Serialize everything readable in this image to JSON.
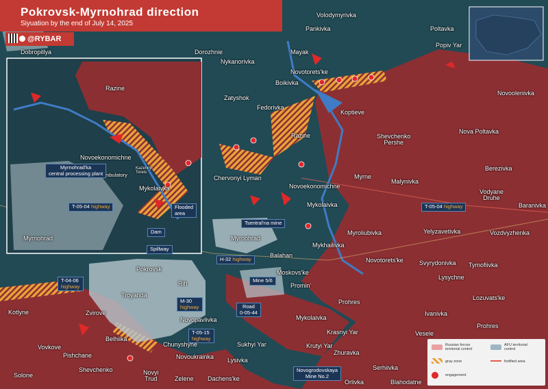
{
  "header": {
    "title": "Pokrovsk-Myrnohrad direction",
    "subtitle": "Siyuation by the end of July 14, 2025"
  },
  "brand": {
    "name": "@RYBAR"
  },
  "colors": {
    "russian": "#8c2f33",
    "ukrainian": "#214a55",
    "gray_zone": "#e8a23a",
    "engagement": "#e02828",
    "urban": "#b6c6cc",
    "water": "#3f7cc5",
    "header": "#c23a33"
  },
  "towns": {
    "volodymyrivka": "Volodymyrivka",
    "pankivka": "Pankivka",
    "poltavka": "Poltavka",
    "popiv_yar": "Popiv Yar",
    "dobropillya": "Dobropillya",
    "dorozhnie": "Dorozhnie",
    "mayak": "Mayak",
    "novotoretske_n": "Novotorets'ke",
    "nykanorivka": "Nykanorivka",
    "boikivka": "Boikivka",
    "novoolenivka": "Novoolenivka",
    "zatyshok": "Zatyshok",
    "fedorivka": "Fedorivka",
    "koptieve": "Koptieve",
    "nova_poltavka": "Nova Poltavka",
    "shevchenko_pershe": "Shevchenko\nPershe",
    "razine_main": "Razine",
    "berezivka": "Berezivka",
    "chervonyi_lyman": "Chervonyi Lyman",
    "myrne": "Myrne",
    "malynivka": "Malynivka",
    "vodyane_druhe": "Vodyane\nDruhe",
    "novoekonomichne_main": "Novoekonomichne",
    "baranivka": "Baranivka",
    "mykolaivka_main": "Mykolaivka",
    "myrnohrad_main": "Myrnohrad",
    "myroliubivka": "Myroliubivka",
    "yelyzavetivka": "Yelyzavetivka",
    "vozdvyzhenka": "Vozdvyzhenka",
    "mykhailivka": "Mykhailivka",
    "novotoretske_s": "Novotorets'ke",
    "svyrydonivka": "Svyrydonivka",
    "tymofiivka": "Tymofiivka",
    "balahan": "Balahan",
    "pokrovsk": "Pokrovsk",
    "moskovske": "Moskovs'ke",
    "lysychne": "Lysychne",
    "lozuvatske": "Lozuvats'ke",
    "promin": "Promin'",
    "rih": "Rih",
    "troyanda": "Troyanda",
    "prohres": "Prohres",
    "kotlyne": "Kotlyne",
    "zvirove": "Zvirove",
    "ivanivka": "Ivanivka",
    "mykolaivka_s": "Mykolaivka",
    "novopavlivka": "Novopavlivka",
    "vesele": "Vesele",
    "belhiika": "Belhiika",
    "krasnyi_yar": "Krasnyi Yar",
    "vovkove": "Vovkove",
    "chunyshyne": "Chunyshyne",
    "sukhyi_yar": "Sukhyi Yar",
    "pishchane": "Pishchane",
    "novoukrainka": "Novoukrainka",
    "krutyi_yar": "Krutyi Yar",
    "zhuravka": "Zhuravka",
    "shevchenko_s": "Shevchenko",
    "lysivka": "Lysivka",
    "solone": "Solone",
    "novyi_trud": "Novyi\nTrud",
    "zelene": "Zelene",
    "dachenske": "Dachens'ke",
    "serhiivka": "Serhiivka",
    "orlivka": "Orlivka",
    "blahodatne": "Blahodatne",
    "razine_inset": "Razine",
    "novoekonomichne_inset": "Novoekonomichne",
    "mykolaivka_inset": "Mykolaivka",
    "myrnohrad_inset": "Myrnohrad",
    "ambulatory": "Ambulatory",
    "kazennyi_torets": "Kazennyi\nTorets"
  },
  "inset_tags": {
    "central_plant": "Myrnohrad'ka\ncentral processing plant",
    "t0504_road": "T-05-04",
    "t0504_hw": "highway",
    "flooded": "Flooded\narea",
    "dam": "Dam",
    "spillway": "Spillway"
  },
  "tags": {
    "t0504_road": "T-05-04",
    "t0504_hw": "highway",
    "tsentralna": "Tsentral'na mine",
    "h32_road": "H-32",
    "h32_hw": "highway",
    "mine56": "Mine 5/6",
    "t0406_road": "T-04-06",
    "t0406_hw": "highway",
    "m30_road": "M-30",
    "m30_hw": "highway",
    "road_0_05": "Road\n0-05-44",
    "t0515_road": "T-05-15",
    "t0515_hw": "highway",
    "novohrodivska": "Novogrodovskaya\nMine No.2"
  },
  "legend": {
    "russian": "Russian forces\nterritorial control",
    "afu": "AFU territorial\ncontrol",
    "gray": "gray zone",
    "fortified": "fortified area",
    "engagement": "engagement"
  }
}
